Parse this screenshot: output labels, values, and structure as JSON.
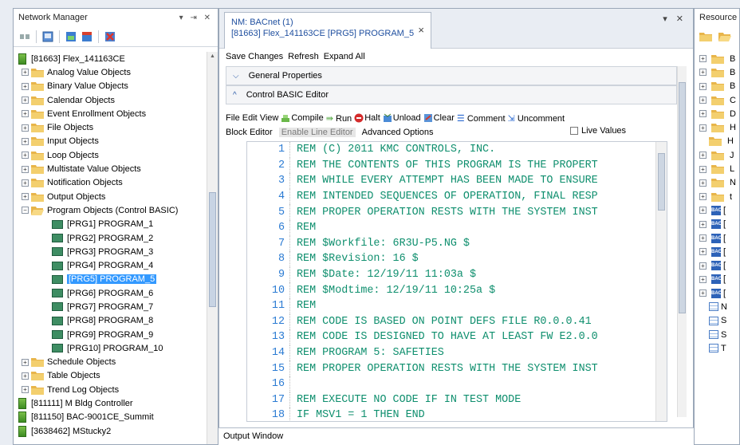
{
  "network_manager": {
    "title": "Network Manager",
    "window_controls": "▾ ⇥ ✕",
    "tree": [
      {
        "kind": "device",
        "label": "[81663] Flex_141163CE"
      },
      {
        "kind": "folder",
        "label": "Analog Value Objects"
      },
      {
        "kind": "folder",
        "label": "Binary Value Objects"
      },
      {
        "kind": "folder",
        "label": "Calendar Objects"
      },
      {
        "kind": "folder",
        "label": "Event Enrollment Objects"
      },
      {
        "kind": "folder",
        "label": "File Objects"
      },
      {
        "kind": "folder",
        "label": "Input Objects"
      },
      {
        "kind": "folder",
        "label": "Loop Objects"
      },
      {
        "kind": "folder",
        "label": "Multistate Value Objects"
      },
      {
        "kind": "folder",
        "label": "Notification Objects"
      },
      {
        "kind": "folder",
        "label": "Output Objects"
      },
      {
        "kind": "folder-open",
        "label": "Program Objects (Control BASIC)"
      },
      {
        "kind": "program",
        "label": "[PRG1] PROGRAM_1"
      },
      {
        "kind": "program",
        "label": "[PRG2] PROGRAM_2"
      },
      {
        "kind": "program",
        "label": "[PRG3] PROGRAM_3"
      },
      {
        "kind": "program",
        "label": "[PRG4] PROGRAM_4"
      },
      {
        "kind": "program-selected",
        "label": "[PRG5] PROGRAM_5"
      },
      {
        "kind": "program",
        "label": "[PRG6] PROGRAM_6"
      },
      {
        "kind": "program",
        "label": "[PRG7] PROGRAM_7"
      },
      {
        "kind": "program",
        "label": "[PRG8] PROGRAM_8"
      },
      {
        "kind": "program",
        "label": "[PRG9] PROGRAM_9"
      },
      {
        "kind": "program",
        "label": "[PRG10] PROGRAM_10"
      },
      {
        "kind": "folder",
        "label": "Schedule Objects"
      },
      {
        "kind": "folder",
        "label": "Table Objects"
      },
      {
        "kind": "folder",
        "label": "Trend Log Objects"
      },
      {
        "kind": "device",
        "label": "[811111] M Bldg Controller"
      },
      {
        "kind": "device",
        "label": "[811150] BAC-9001CE_Summit"
      },
      {
        "kind": "device",
        "label": "[3638462] MStucky2"
      }
    ]
  },
  "document": {
    "tab_line1": "NM: BACnet (1)",
    "tab_line2": "[81663] Flex_141163CE [PRG5] PROGRAM_5",
    "tab_close": "×",
    "window_controls": "▾ ✕",
    "menu": [
      "Save Changes",
      "Refresh",
      "Expand All"
    ],
    "section_general": "General Properties",
    "section_editor": "Control BASIC Editor",
    "editor_toolbar": {
      "file": "File",
      "edit": "Edit",
      "view": "View",
      "compile": "Compile",
      "run": "Run",
      "halt": "Halt",
      "unload": "Unload",
      "clear": "Clear",
      "comment": "Comment",
      "uncomment": "Uncomment"
    },
    "editor_tabs": {
      "block_editor": "Block Editor",
      "line_editor": "Enable Line Editor",
      "advanced": "Advanced Options",
      "live_values": "Live Values"
    },
    "code_lines": [
      {
        "n": "1",
        "t": "REM (C) 2011 KMC CONTROLS, INC."
      },
      {
        "n": "2",
        "t": "REM THE CONTENTS OF THIS PROGRAM IS THE PROPERT"
      },
      {
        "n": "3",
        "t": "REM WHILE EVERY ATTEMPT HAS BEEN MADE TO ENSURE"
      },
      {
        "n": "4",
        "t": "REM INTENDED SEQUENCES OF OPERATION, FINAL RESP"
      },
      {
        "n": "5",
        "t": "REM PROPER OPERATION RESTS WITH THE SYSTEM INST"
      },
      {
        "n": "6",
        "t": "REM"
      },
      {
        "n": "7",
        "t": "REM  $Workfile: 6R3U-P5.NG $"
      },
      {
        "n": "8",
        "t": "REM  $Revision: 16 $"
      },
      {
        "n": "9",
        "t": "REM  $Date: 12/19/11 11:03a $"
      },
      {
        "n": "10",
        "t": "REM  $Modtime: 12/19/11 10:25a $"
      },
      {
        "n": "11",
        "t": "REM"
      },
      {
        "n": "12",
        "t": "REM CODE IS BASED ON POINT DEFS FILE R0.0.0.41"
      },
      {
        "n": "13",
        "t": "REM CODE IS DESIGNED TO HAVE AT LEAST FW E2.0.0"
      },
      {
        "n": "14",
        "t": "REM PROGRAM 5: SAFETIES"
      },
      {
        "n": "15",
        "t": "REM PROPER OPERATION RESTS WITH THE SYSTEM INST"
      },
      {
        "n": "16",
        "t": ""
      },
      {
        "n": "17",
        "t": "REM EXECUTE NO CODE IF IN TEST MODE"
      },
      {
        "n": "18",
        "t": "IF MSV1 = 1 THEN END"
      }
    ]
  },
  "output": {
    "title": "Output Window"
  },
  "resources": {
    "title": "Resource",
    "rows": [
      {
        "kind": "folder",
        "label": "B"
      },
      {
        "kind": "folder",
        "label": "B"
      },
      {
        "kind": "folder",
        "label": "B"
      },
      {
        "kind": "folder",
        "label": "C"
      },
      {
        "kind": "folder",
        "label": "D"
      },
      {
        "kind": "folder",
        "label": "H"
      },
      {
        "kind": "folder",
        "label": "H"
      },
      {
        "kind": "folder",
        "label": "J"
      },
      {
        "kind": "folder",
        "label": "L"
      },
      {
        "kind": "folder",
        "label": "N"
      },
      {
        "kind": "folder",
        "label": "t"
      },
      {
        "kind": "bac",
        "label": "["
      },
      {
        "kind": "bac",
        "label": "["
      },
      {
        "kind": "bac",
        "label": "["
      },
      {
        "kind": "bac",
        "label": "["
      },
      {
        "kind": "bac",
        "label": "["
      },
      {
        "kind": "bac",
        "label": "["
      },
      {
        "kind": "bac",
        "label": "["
      },
      {
        "kind": "table",
        "label": "N"
      },
      {
        "kind": "table",
        "label": "S"
      },
      {
        "kind": "table",
        "label": "S"
      },
      {
        "kind": "table",
        "label": "T"
      }
    ]
  },
  "colors": {
    "selection": "#3399ff",
    "code_text": "#0f8f6e",
    "line_numbers": "#2b7bd3"
  }
}
